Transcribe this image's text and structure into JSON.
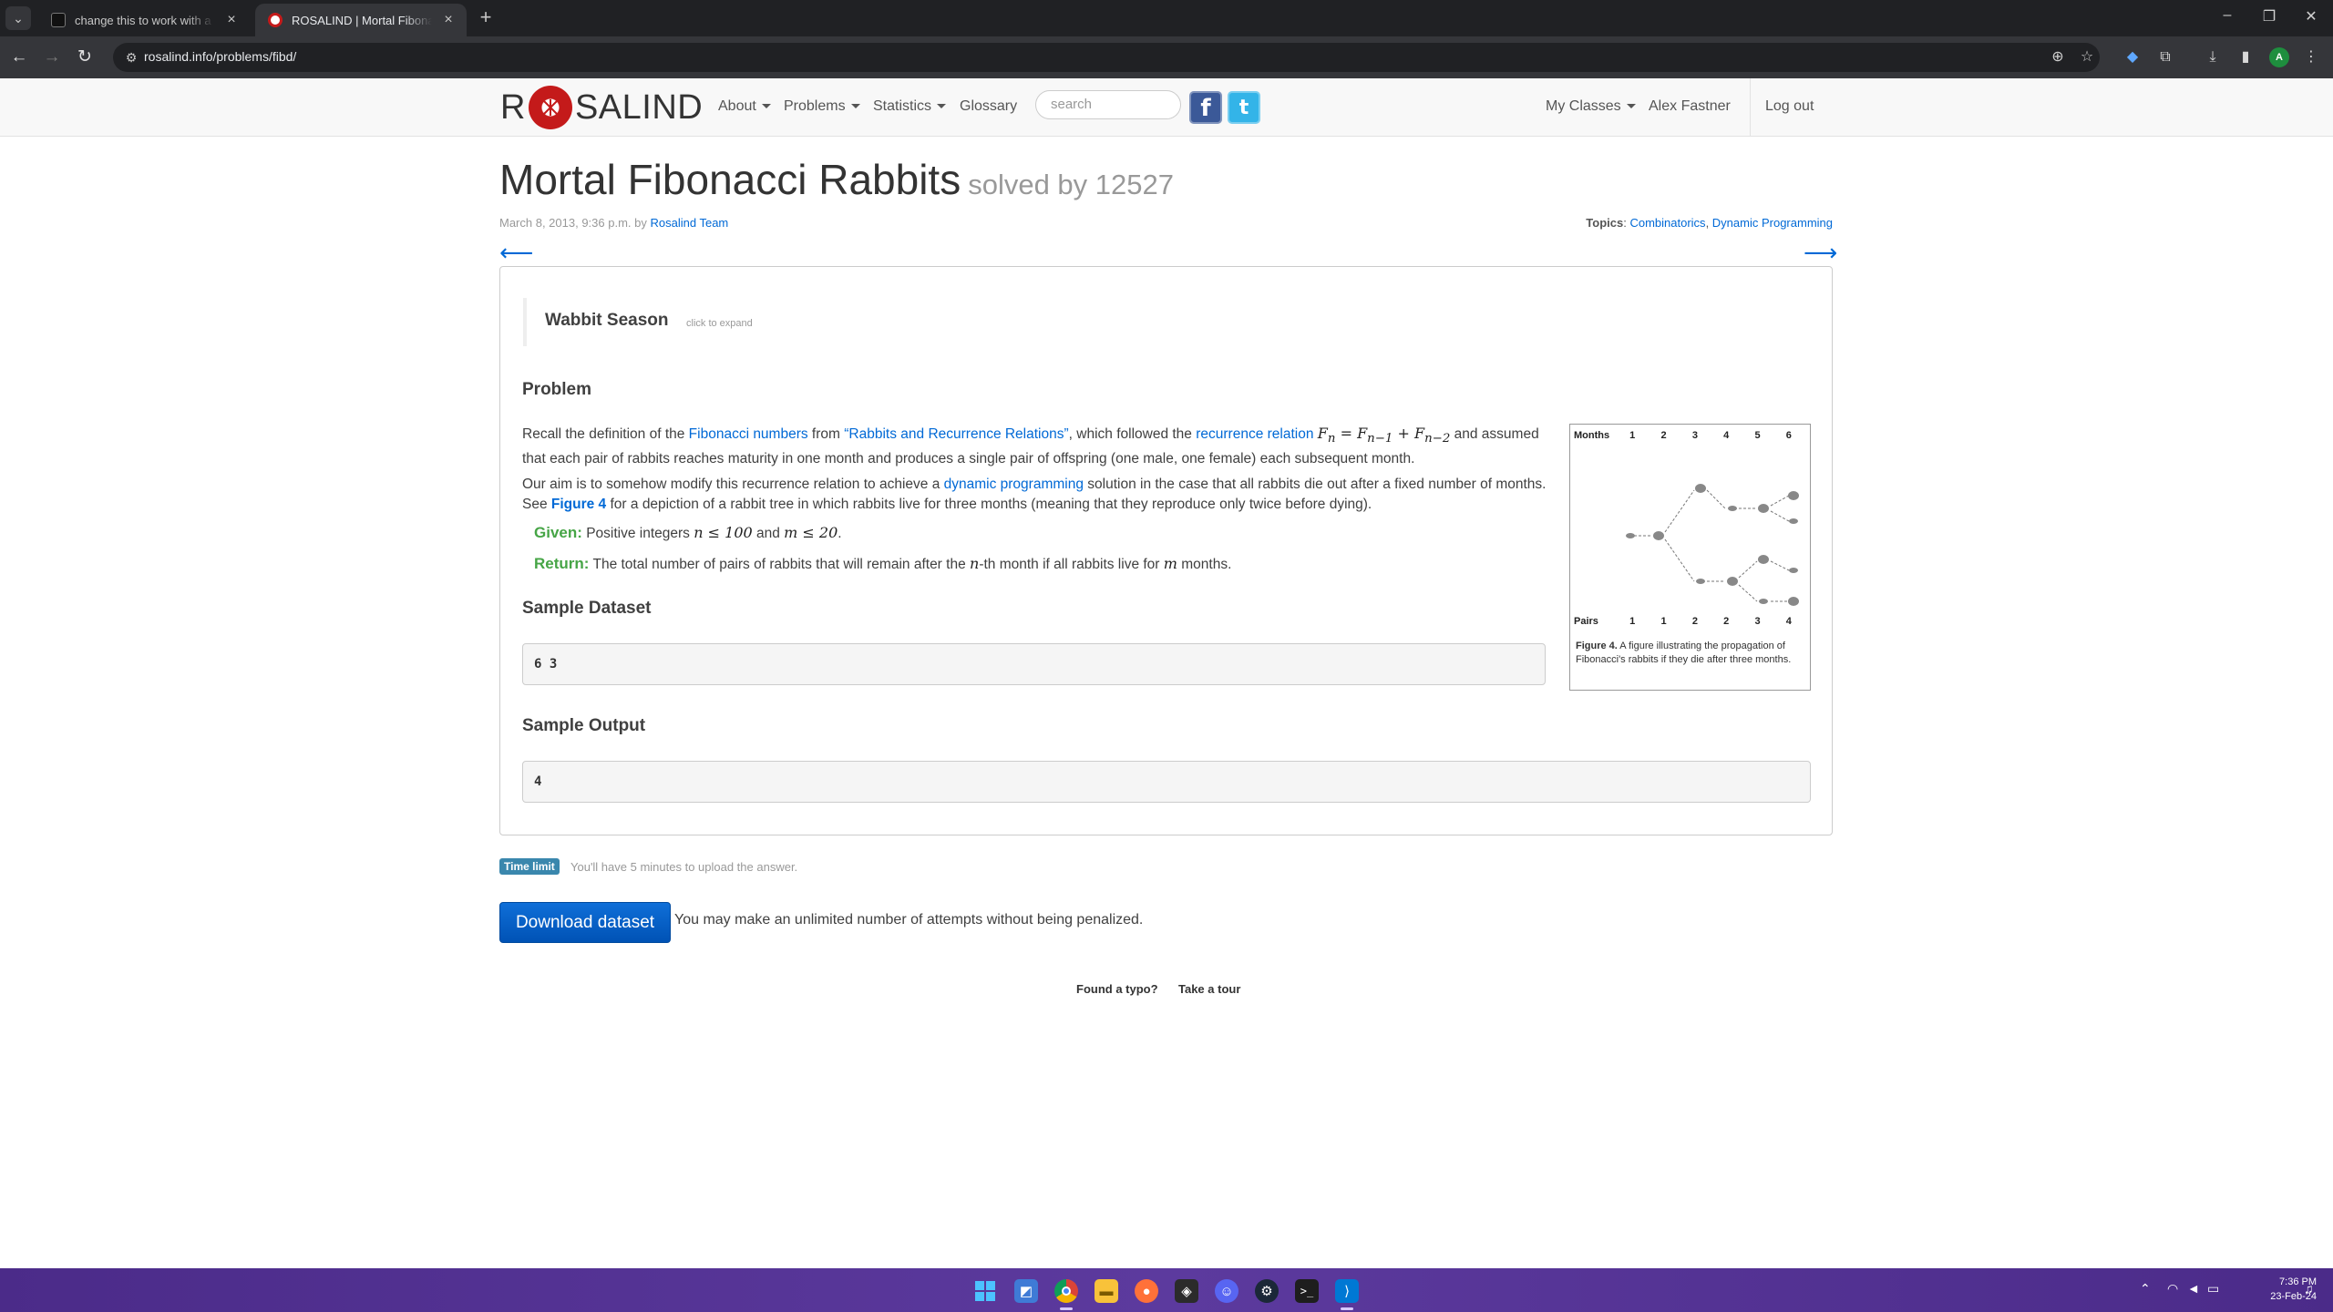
{
  "browser": {
    "tabs": [
      {
        "title": "change this to work with a multiple",
        "active": false
      },
      {
        "title": "ROSALIND | Mortal Fibonacci Rabbits",
        "active": true
      }
    ],
    "url": "rosalind.info/problems/fibd/"
  },
  "site": {
    "logo_left": "R",
    "logo_right": "SALIND",
    "nav": {
      "about": "About",
      "problems": "Problems",
      "statistics": "Statistics",
      "glossary": "Glossary",
      "search_placeholder": "search",
      "my_classes": "My Classes",
      "user": "Alex Fastner",
      "logout": "Log out"
    }
  },
  "problem": {
    "title": "Mortal Fibonacci Rabbits",
    "solved_by": "solved by 12527",
    "date": "March 8, 2013, 9:36 p.m. by",
    "author": "Rosalind Team",
    "topics_label": "Topics",
    "topics": [
      "Combinatorics",
      "Dynamic Programming"
    ],
    "season_title": "Wabbit Season",
    "season_hint": "click to expand",
    "problem_heading": "Problem",
    "p1": {
      "t1": "Recall the definition of the ",
      "l1": "Fibonacci numbers",
      "t2": " from ",
      "l2": "“Rabbits and Recurrence Relations”",
      "t3": ", which followed the ",
      "l3": "recurrence relation",
      "t4": " ",
      "m1": "F",
      "m1sub": "n",
      "m2": " = F",
      "m2sub": "n−1",
      "m3": " + F",
      "m3sub": "n−2",
      "t5": " and assumed that each pair of rabbits reaches maturity in one month and produces a single pair of offspring (one male, one female) each subsequent month."
    },
    "p2": {
      "t1": "Our aim is to somehow modify this recurrence relation to achieve a ",
      "l1": "dynamic programming",
      "t2": " solution in the case that all rabbits die out after a fixed number of months. See ",
      "l2": "Figure 4",
      "t3": " for a depiction of a rabbit tree in which rabbits live for three months (meaning that they reproduce only twice before dying)."
    },
    "given": {
      "label": "Given:",
      "t1": " Positive integers ",
      "m1": "n ≤ 100",
      "t2": " and ",
      "m2": "m ≤ 20",
      "t3": "."
    },
    "ret": {
      "label": "Return:",
      "t1": " The total number of pairs of rabbits that will remain after the ",
      "m1": "n",
      "t2": "-th month if all rabbits live for ",
      "m2": "m",
      "t3": " months."
    },
    "sample_dataset_heading": "Sample Dataset",
    "sample_dataset": "6 3",
    "sample_output_heading": "Sample Output",
    "sample_output": "4",
    "figure": {
      "months_label": "Months",
      "months": [
        "1",
        "2",
        "3",
        "4",
        "5",
        "6"
      ],
      "pairs_label": "Pairs",
      "pairs": [
        "1",
        "1",
        "2",
        "2",
        "3",
        "4"
      ],
      "caption_bold": "Figure 4.",
      "caption": " A figure illustrating the propagation of Fibonacci's rabbits if they die after three months."
    },
    "time_limit_badge": "Time limit",
    "time_limit_note": "You'll have 5 minutes to upload the answer.",
    "download_label": "Download dataset",
    "attempts_note": "You may make an unlimited number of attempts without being penalized.",
    "footer": {
      "typo": "Found a typo?",
      "tour": "Take a tour"
    }
  },
  "taskbar": {
    "time": "7:36 PM",
    "date": "23-Feb-24"
  },
  "colors": {
    "link": "#0069d6",
    "given_green": "#46a546",
    "badge_blue": "#3a87ad",
    "button_blue": "#0052b5",
    "logo_red": "#c41a1a",
    "taskbar_purple": "#5c3a9e"
  }
}
